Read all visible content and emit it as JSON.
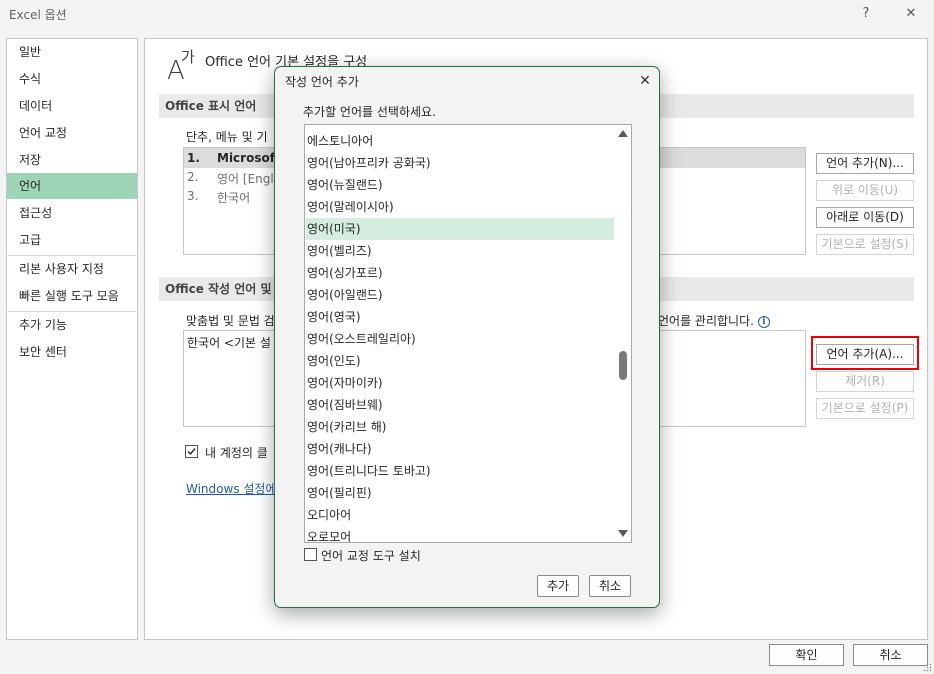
{
  "window": {
    "title": "Excel 옵션",
    "help_glyph": "?",
    "close_glyph": "✕"
  },
  "sidebar": {
    "items": [
      {
        "label": "일반"
      },
      {
        "label": "수식"
      },
      {
        "label": "데이터"
      },
      {
        "label": "언어 교정"
      },
      {
        "label": "저장"
      },
      {
        "label": "언어",
        "selected": true
      },
      {
        "label": "접근성"
      },
      {
        "label": "고급"
      },
      {
        "label": "리본 사용자 지정"
      },
      {
        "label": "빠른 실행 도구 모음"
      },
      {
        "label": "추가 기능"
      },
      {
        "label": "보안 센터"
      }
    ]
  },
  "main": {
    "header_glyph": "A가",
    "header_title": "Office 언어 기본 설정을 구성",
    "display_section": {
      "heading": "Office 표시 언어",
      "caption": "단추, 메뉴 및 기",
      "list": [
        {
          "num": "1.",
          "text": "Microsoft"
        },
        {
          "num": "2.",
          "text": "영어 [Engli"
        },
        {
          "num": "3.",
          "text": "한국어"
        }
      ],
      "buttons": {
        "add": "언어 추가(N)...",
        "move_up": "위로 이동(U)",
        "move_down": "아래로 이동(D)",
        "set_default": "기본으로 설정(S)"
      }
    },
    "authoring_section": {
      "heading": "Office 작성 언어 및",
      "caption_left": "맞춤법 및 문법 검",
      "caption_right": "언어를 관리합니다.",
      "info_glyph": "i",
      "list": [
        "한국어 <기본 설"
      ],
      "buttons": {
        "add": "언어 추가(A)...",
        "remove": "제거(R)",
        "set_default": "기본으로 설정(P)"
      },
      "checkbox_label": "내 계정의 클",
      "checkbox_checked": true,
      "link": "Windows 설정에"
    }
  },
  "footer": {
    "ok": "확인",
    "cancel": "취소"
  },
  "dialog": {
    "title": "작성 언어 추가",
    "close_glyph": "✕",
    "prompt": "추가할 언어를 선택하세요.",
    "languages": [
      "에스토니아어",
      "영어(남아프리카 공화국)",
      "영어(뉴질랜드)",
      "영어(말레이시아)",
      "영어(미국)",
      "영어(벨리즈)",
      "영어(싱가포르)",
      "영어(아일랜드)",
      "영어(영국)",
      "영어(오스트레일리아)",
      "영어(인도)",
      "영어(자마이카)",
      "영어(짐바브웨)",
      "영어(카리브 해)",
      "영어(캐나다)",
      "영어(트리니다드 토바고)",
      "영어(필리핀)",
      "오디아어",
      "오로모어"
    ],
    "selected_language": "영어(미국)",
    "proofing_checkbox_label": "언어 교정 도구 설치",
    "proofing_checked": false,
    "add_button": "추가",
    "cancel_button": "취소"
  },
  "colors": {
    "selection_sidebar": "#9fd5b7",
    "selection_list": "#d4eddf",
    "dialog_border": "#1e7145",
    "highlight_red": "#e8000b",
    "link": "#1f5da7"
  }
}
